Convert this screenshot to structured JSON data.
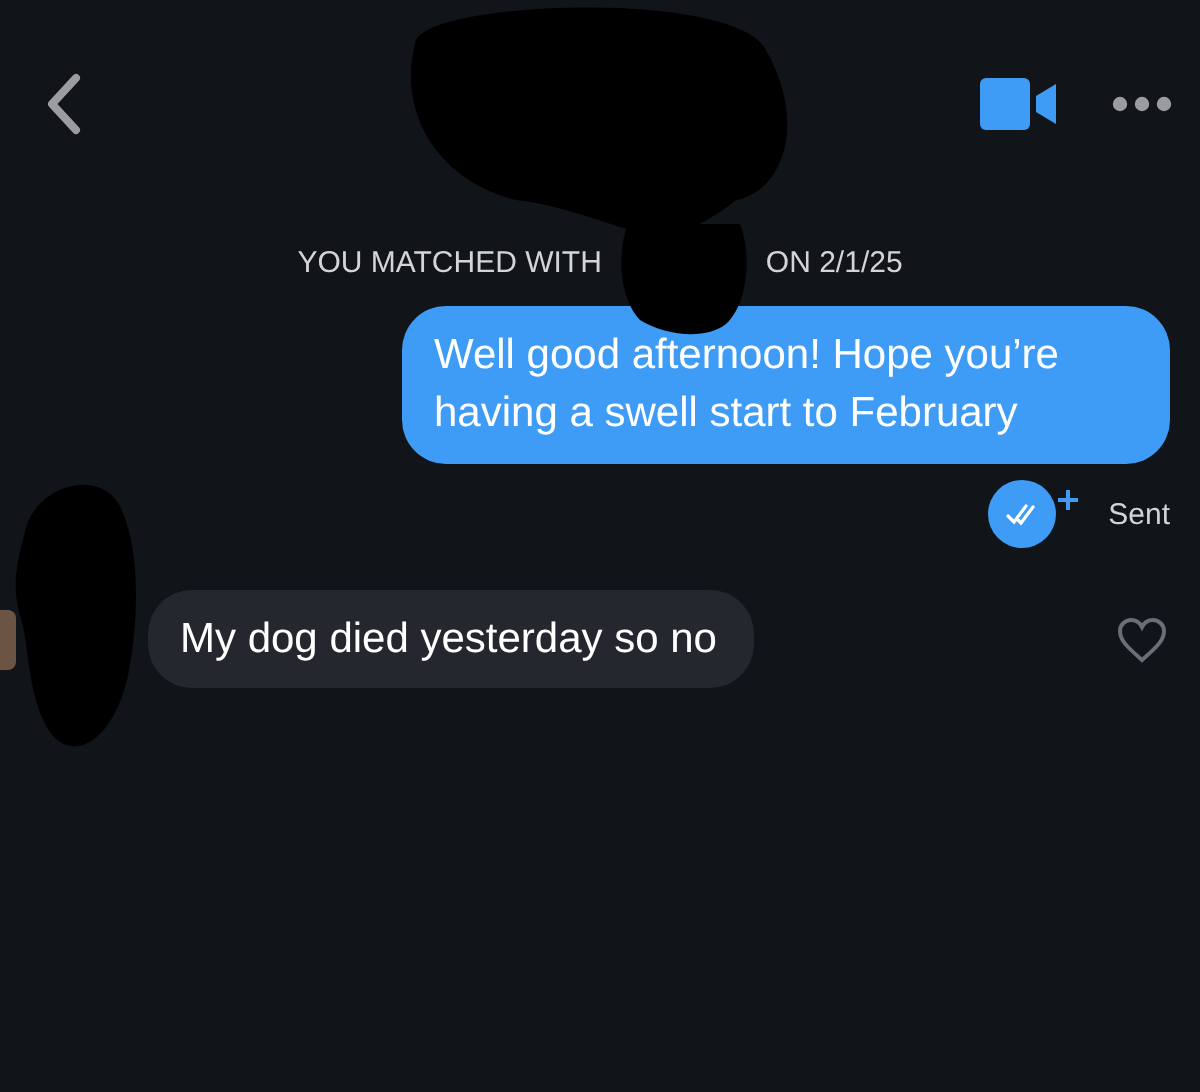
{
  "match_note": {
    "prefix": "YOU MATCHED WITH",
    "suffix": "ON 2/1/25"
  },
  "messages": [
    {
      "kind": "outgoing",
      "text": "Well good afternoon! Hope you’re having a swell start to February",
      "status": "Sent"
    },
    {
      "kind": "incoming",
      "text": "My dog died yesterday so no",
      "liked": false
    }
  ]
}
